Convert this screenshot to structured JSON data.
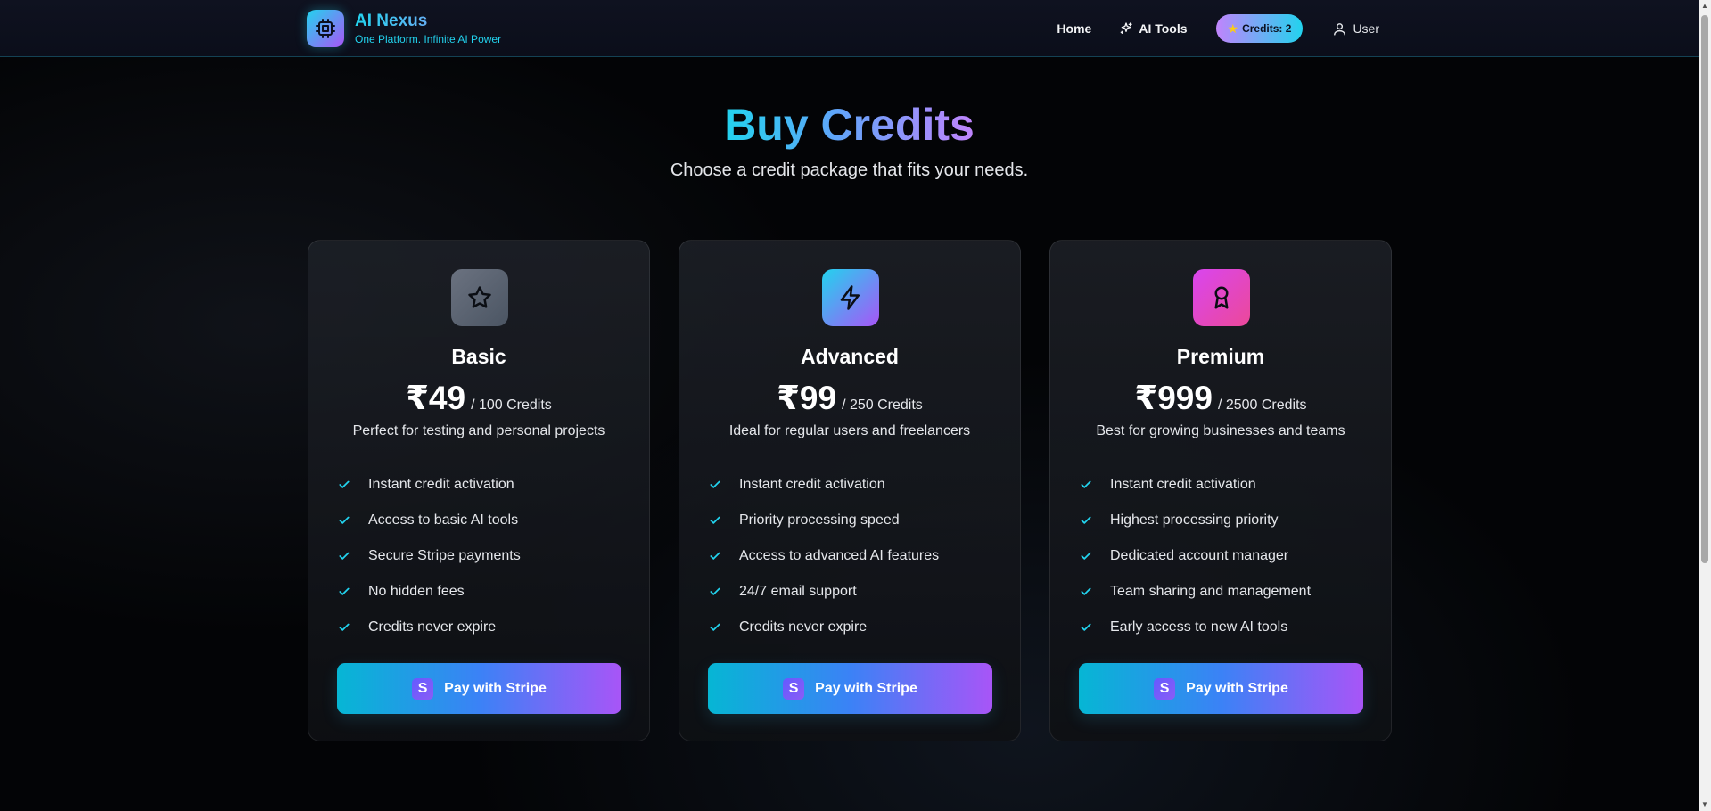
{
  "nav": {
    "brand_title": "AI Nexus",
    "brand_tagline": "One Platform. Infinite AI Power",
    "home": "Home",
    "ai_tools": "AI Tools",
    "credits": "Credits: 2",
    "user": "User"
  },
  "page": {
    "title": "Buy Credits",
    "subtitle": "Choose a credit package that fits your needs."
  },
  "plans": [
    {
      "name": "Basic",
      "price": "₹49",
      "credits": "/ 100 Credits",
      "description": "Perfect for testing and personal projects",
      "icon": "star-icon",
      "features": [
        "Instant credit activation",
        "Access to basic AI tools",
        "Secure Stripe payments",
        "No hidden fees",
        "Credits never expire"
      ],
      "button": "Pay with Stripe"
    },
    {
      "name": "Advanced",
      "price": "₹99",
      "credits": "/ 250 Credits",
      "description": "Ideal for regular users and freelancers",
      "icon": "lightning-icon",
      "features": [
        "Instant credit activation",
        "Priority processing speed",
        "Access to advanced AI features",
        "24/7 email support",
        "Credits never expire"
      ],
      "button": "Pay with Stripe"
    },
    {
      "name": "Premium",
      "price": "₹999",
      "credits": "/ 2500 Credits",
      "description": "Best for growing businesses and teams",
      "icon": "award-icon",
      "features": [
        "Instant credit activation",
        "Highest processing priority",
        "Dedicated account manager",
        "Team sharing and management",
        "Early access to new AI tools"
      ],
      "button": "Pay with Stripe"
    }
  ],
  "stripe_logo_letter": "S",
  "colors": {
    "accent_cyan": "#22d3ee",
    "accent_purple": "#a855f7",
    "basic_icon_bg": "#6b7280",
    "advanced_icon_bg": "#22d3ee-#a855f7",
    "premium_icon_bg": "#d946ef-#ec4899"
  }
}
